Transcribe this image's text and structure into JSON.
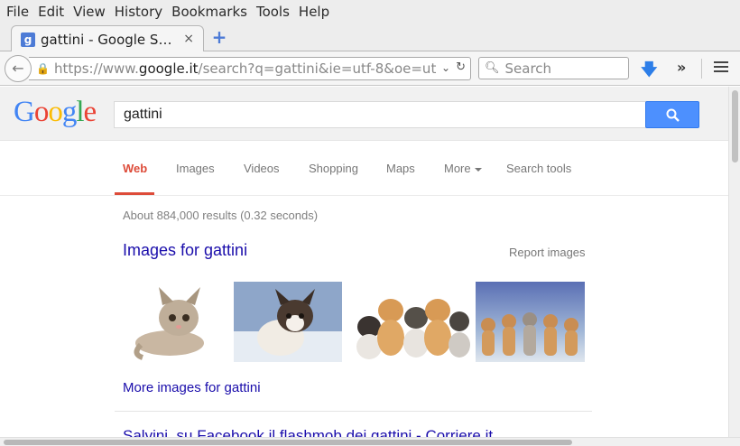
{
  "menubar": {
    "items": [
      "File",
      "Edit",
      "View",
      "History",
      "Bookmarks",
      "Tools",
      "Help"
    ]
  },
  "tab": {
    "favicon": "g",
    "title": "gattini - Google S…",
    "close": "×",
    "new_tab": "+"
  },
  "navbar": {
    "url_grey_prefix": "https://www.",
    "url_domain": "google.it",
    "url_rest": "/search?q=gattini&ie=utf-8&oe=ut",
    "search_placeholder": "Search"
  },
  "google": {
    "query": "gattini",
    "tabs": [
      "Web",
      "Images",
      "Videos",
      "Shopping",
      "Maps",
      "More",
      "Search tools"
    ],
    "stats": "About 884,000 results (0.32 seconds)",
    "images_title": "Images for gattini",
    "report_images": "Report images",
    "more_images": "More images for gattini",
    "result_title": "Salvini, su Facebook il flashmob dei gattini - Corriere.it"
  },
  "colors": {
    "link": "#1a0dab",
    "active_tab": "#dd4b39",
    "search_button": "#4d90fe"
  }
}
